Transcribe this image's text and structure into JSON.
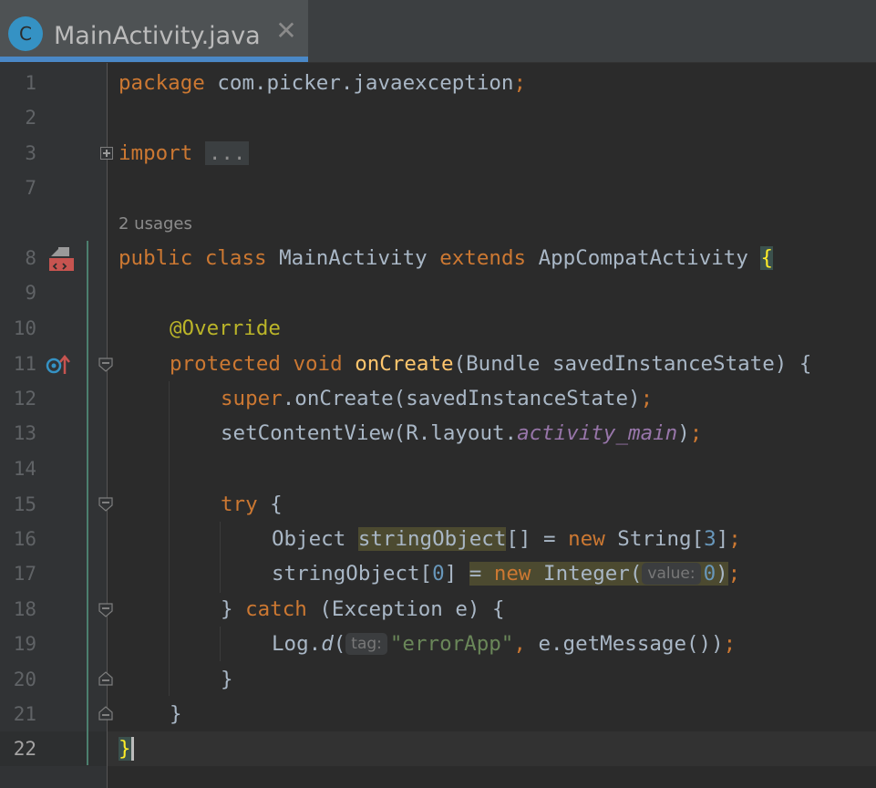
{
  "tab": {
    "icon_letter": "C",
    "title": "MainActivity.java",
    "close_glyph": "✕"
  },
  "line_numbers": [
    "1",
    "2",
    "3",
    "7",
    "",
    "8",
    "9",
    "10",
    "11",
    "12",
    "13",
    "14",
    "15",
    "16",
    "17",
    "18",
    "19",
    "20",
    "21",
    "22"
  ],
  "usages_label": "2 usages",
  "code": {
    "l1": {
      "kw": "package",
      "rest": " com.picker.javaexception",
      "semi": ";"
    },
    "l3": {
      "kw": "import",
      "ellipsis": "..."
    },
    "l8": {
      "kw1": "public",
      "kw2": "class",
      "name": " MainActivity ",
      "kw3": "extends",
      "parent": " AppCompatActivity ",
      "brace": "{"
    },
    "l10": {
      "annotation": "@Override"
    },
    "l11": {
      "kw1": "protected",
      "kw2": "void",
      "method": "onCreate",
      "rest": "(Bundle savedInstanceState) {"
    },
    "l12": {
      "kw": "super",
      "rest": ".onCreate(savedInstanceState)",
      "semi": ";"
    },
    "l13": {
      "pre": "setContentView(R.layout.",
      "field": "activity_main",
      "post": ")",
      "semi": ";"
    },
    "l15": {
      "kw": "try",
      "rest": " {"
    },
    "l16": {
      "pre": "Object ",
      "var": "stringObject",
      "mid": "[] = ",
      "kw": "new",
      "type": " String[",
      "num": "3",
      "post": "]",
      "semi": ";"
    },
    "l17": {
      "pre": "stringObject[",
      "num": "0",
      "mid": "] ",
      "eq": "= ",
      "kw": "new",
      "type": " Integer(",
      "hint": "value:",
      "num2": "0",
      "post": ")",
      "semi": ";"
    },
    "l18": {
      "pre": "} ",
      "kw": "catch",
      "rest": " (Exception e) {"
    },
    "l19": {
      "pre": "Log.",
      "method": "d",
      "paren": "(",
      "hint": "tag:",
      "str": "\"errorApp\"",
      "comma": ",",
      "rest": " e.getMessage())",
      "semi": ";"
    },
    "l20": {
      "text": "}"
    },
    "l21": {
      "text": "}"
    },
    "l22": {
      "text": "}"
    }
  },
  "icons": {
    "run_gutter": "implemented-class-icon",
    "override_gutter": "overrides-method-icon"
  }
}
